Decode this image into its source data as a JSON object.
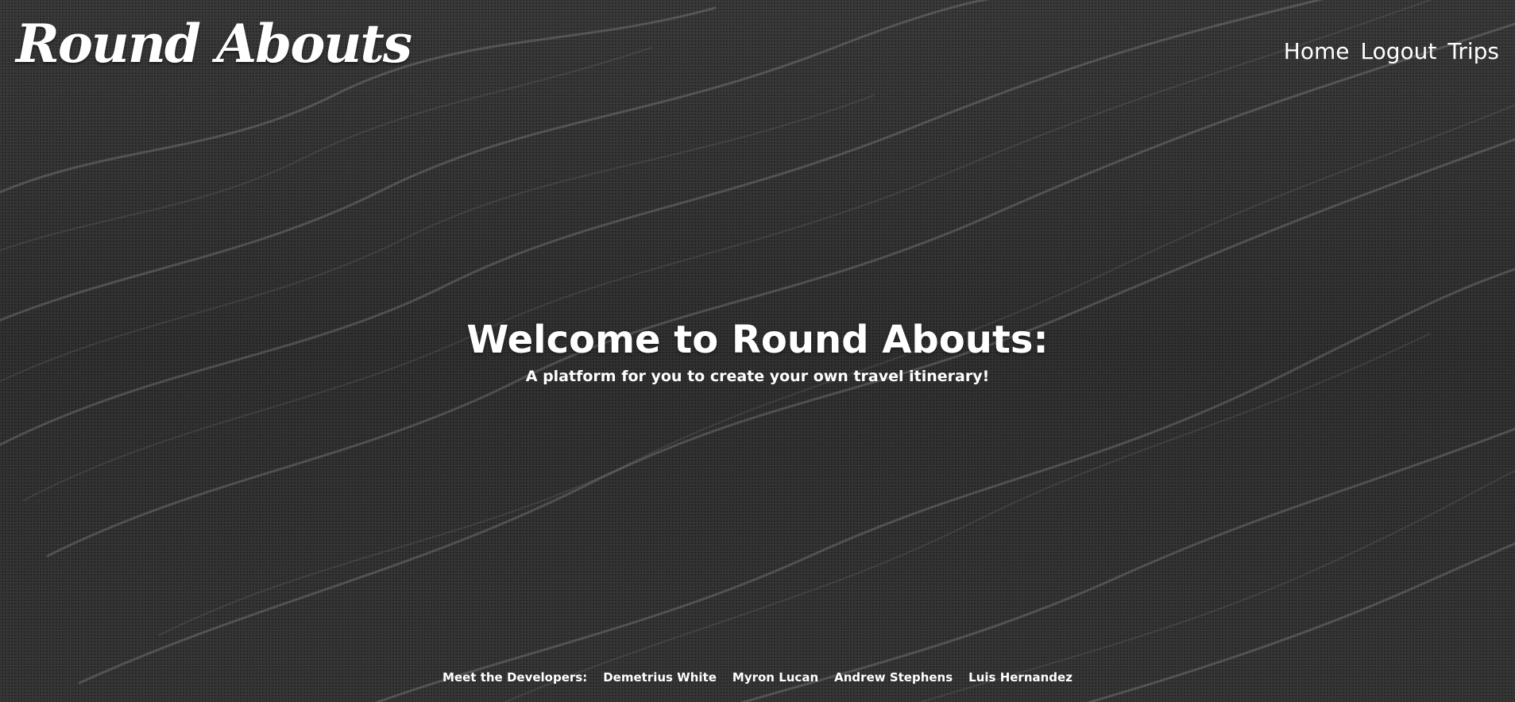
{
  "header": {
    "logo_text": "Round Abouts",
    "nav": [
      {
        "label": "Home"
      },
      {
        "label": "Logout"
      },
      {
        "label": "Trips"
      }
    ]
  },
  "hero": {
    "title": "Welcome to Round Abouts:",
    "subtitle": "A platform for you to create your own travel itinerary!"
  },
  "footer": {
    "label": "Meet the Developers:",
    "developers": [
      {
        "name": "Demetrius White"
      },
      {
        "name": "Myron Lucan"
      },
      {
        "name": "Andrew Stephens"
      },
      {
        "name": "Luis Hernandez"
      }
    ]
  },
  "colors": {
    "text": "#ffffff",
    "background": "#2c2c2c"
  },
  "icons": {
    "background": "black-sand-ripples-image"
  }
}
